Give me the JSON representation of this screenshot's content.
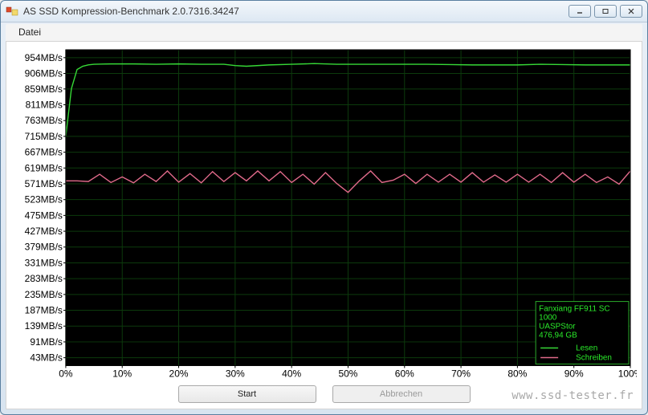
{
  "window": {
    "title": "AS SSD Kompression-Benchmark 2.0.7316.34247"
  },
  "menu": {
    "file": "Datei"
  },
  "buttons": {
    "start": "Start",
    "cancel": "Abbrechen"
  },
  "legend": {
    "device_line1": "Fanxiang FF911 SC",
    "device_line2": "1000",
    "controller": "UASPStor",
    "capacity": "476,94 GB",
    "read": "Lesen",
    "write": "Schreiben"
  },
  "watermark": "www.ssd-tester.fr",
  "chart_data": {
    "type": "line",
    "xlabel": "",
    "ylabel": "",
    "x_unit": "%",
    "y_unit": "MB/s",
    "xlim": [
      0,
      100
    ],
    "ylim": [
      19,
      978
    ],
    "x_ticks": [
      0,
      10,
      20,
      30,
      40,
      50,
      60,
      70,
      80,
      90,
      100
    ],
    "y_ticks": [
      43,
      91,
      139,
      187,
      235,
      283,
      331,
      379,
      427,
      475,
      523,
      571,
      619,
      667,
      715,
      763,
      811,
      859,
      906,
      954
    ],
    "y_tick_labels": [
      "43MB/s",
      "91MB/s",
      "139MB/s",
      "187MB/s",
      "235MB/s",
      "283MB/s",
      "331MB/s",
      "379MB/s",
      "427MB/s",
      "475MB/s",
      "523MB/s",
      "571MB/s",
      "619MB/s",
      "667MB/s",
      "715MB/s",
      "763MB/s",
      "811MB/s",
      "859MB/s",
      "906MB/s",
      " 954MB/s"
    ],
    "series": [
      {
        "name": "Lesen",
        "color": "#36d836",
        "x": [
          0,
          1,
          2,
          3,
          4,
          5,
          8,
          12,
          16,
          20,
          24,
          28,
          30,
          32,
          36,
          40,
          44,
          48,
          52,
          56,
          60,
          64,
          68,
          72,
          76,
          80,
          84,
          88,
          92,
          96,
          100
        ],
        "y": [
          715,
          860,
          918,
          928,
          932,
          934,
          935,
          935,
          934,
          935,
          934,
          934,
          930,
          928,
          932,
          934,
          936,
          934,
          934,
          934,
          934,
          934,
          933,
          932,
          932,
          932,
          934,
          933,
          932,
          932,
          932
        ]
      },
      {
        "name": "Schreiben",
        "color": "#e06a8a",
        "x": [
          0,
          2,
          4,
          6,
          8,
          10,
          12,
          14,
          16,
          18,
          20,
          22,
          24,
          26,
          28,
          30,
          32,
          34,
          36,
          38,
          40,
          42,
          44,
          46,
          48,
          50,
          52,
          54,
          56,
          58,
          60,
          62,
          64,
          66,
          68,
          70,
          72,
          74,
          76,
          78,
          80,
          82,
          84,
          86,
          88,
          90,
          92,
          94,
          96,
          98,
          100
        ],
        "y": [
          580,
          580,
          578,
          600,
          575,
          592,
          574,
          600,
          578,
          610,
          576,
          602,
          574,
          608,
          578,
          605,
          580,
          610,
          580,
          608,
          575,
          600,
          570,
          605,
          572,
          545,
          580,
          610,
          575,
          582,
          600,
          572,
          600,
          576,
          600,
          576,
          605,
          576,
          598,
          576,
          600,
          576,
          600,
          575,
          605,
          576,
          600,
          575,
          592,
          570,
          610
        ]
      }
    ]
  }
}
